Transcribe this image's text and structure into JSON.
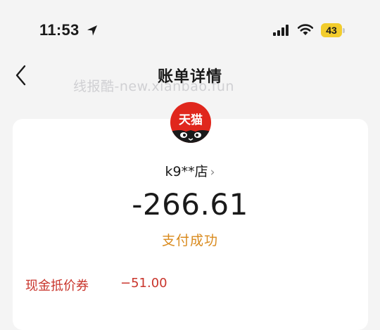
{
  "status_bar": {
    "time": "11:53",
    "battery": "43",
    "icons": [
      "location-arrow-icon",
      "cell-signal-icon",
      "wifi-icon",
      "battery-icon"
    ]
  },
  "nav": {
    "title": "账单详情",
    "back_icon": "chevron-left-icon"
  },
  "watermark": "线报酷-new.xianbao.fun",
  "merchant": {
    "logo_text": "天猫",
    "name": "k9**店",
    "chevron": "›"
  },
  "amount": "-266.61",
  "payment_status": "支付成功",
  "details": [
    {
      "label": "现金抵价券",
      "value": "−51.00"
    }
  ],
  "colors": {
    "accent_status": "#d98a1d",
    "discount": "#c9352c",
    "logo_red": "#e0271d",
    "battery": "#f2cc2c"
  }
}
